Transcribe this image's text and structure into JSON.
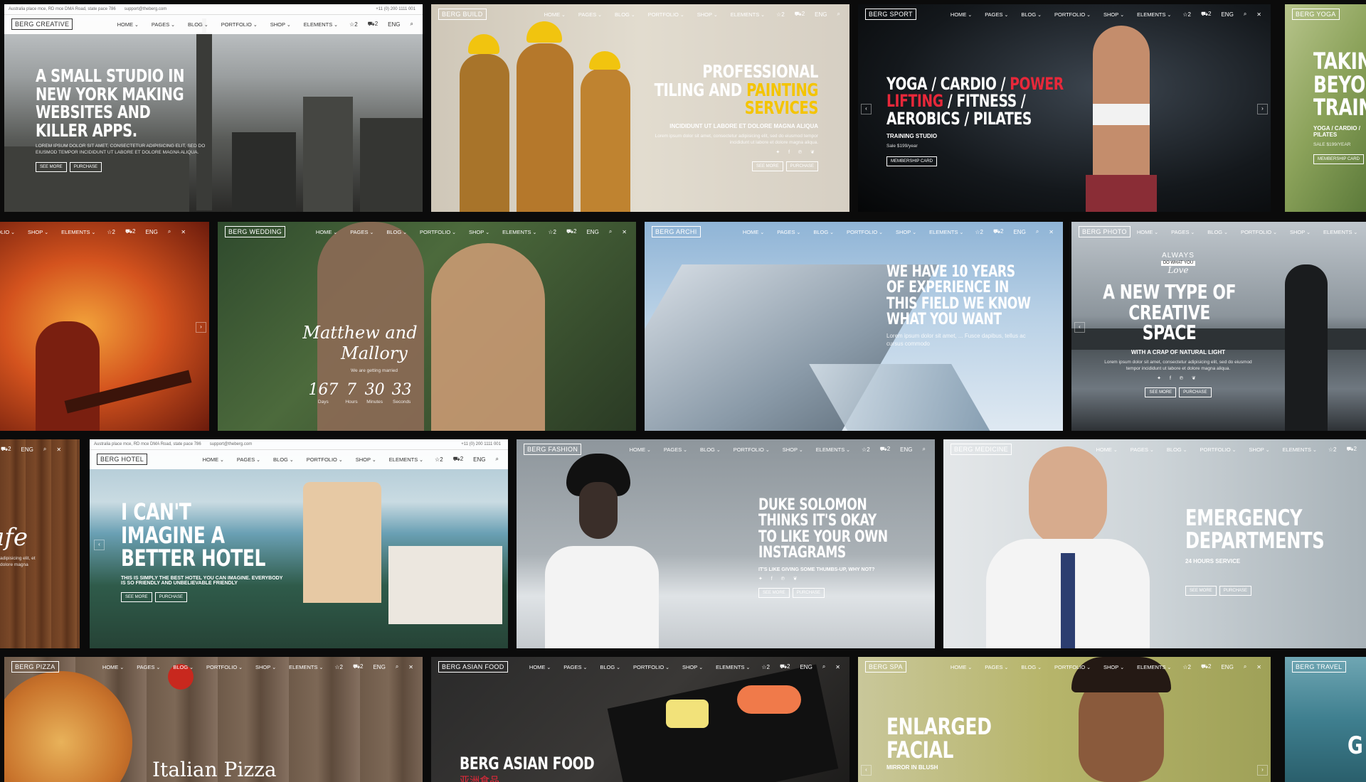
{
  "common_nav": {
    "home": "HOME",
    "pages": "PAGES",
    "blog": "BLOG",
    "portfolio": "PORTFOLIO",
    "shop": "SHOP",
    "elements": "ELEMENTS",
    "wishlist": "☆2",
    "cart": "⛟2",
    "lang": "ENG",
    "search_icon": "⌕",
    "close_icon": "✕"
  },
  "creative": {
    "logo": "BERG CREATIVE",
    "topbar_address": "Australia place mce, RD mce DMA Road, state pace 786",
    "topbar_email": "support@theberg.com",
    "topbar_phone": "+11 (0) 200 1111 001",
    "title": "A SMALL STUDIO IN NEW YORK MAKING WEBSITES AND KILLER APPS.",
    "body": "LOREM IPSUM DOLOR SIT AMET, CONSECTETUR ADIPISICING ELIT, SED DO EIUSMOD TEMPOR INCIDIDUNT UT LABORE ET DOLORE MAGNA ALIQUA.",
    "btn1": "SEE MORE",
    "btn2": "PURCHASE"
  },
  "build": {
    "logo": "BERG BUILD",
    "title_a": "PROFESSIONAL TILING AND",
    "title_b": "PAINTING SERVICES",
    "sub": "INCIDIDUNT UT LABORE ET DOLORE MAGNA ALIQUA",
    "body": "Lorem ipsum dolor sit amet, consectetur adipisicing elit, sed do eiusmod tempor incididunt ut labore et dolore magna aliqua.",
    "social": "✦ f ℗ ❦",
    "btn1": "SEE MORE",
    "btn2": "PURCHASE"
  },
  "sport": {
    "logo": "BERG SPORT",
    "title_a": "YOGA / CARDIO /",
    "title_power": "POWER",
    "title_lifting": "LIFTING",
    "title_b": "/ FITNESS / AEROBICS / PILATES",
    "sub": "TRAINING STUDIO",
    "body": "Sale $199/year",
    "btn1": "MEMBERSHIP CARD"
  },
  "yoga": {
    "logo": "BERG YOGA",
    "title": "TAKING BEYOND TRAIN",
    "sub": "YOGA / CARDIO / PILATES",
    "body": "SALE $199/YEAR",
    "btn1": "MEMBERSHIP CARD"
  },
  "music": {},
  "wedding": {
    "logo": "BERG WEDDING",
    "names_a": "Matthew and",
    "names_b": "Mallory",
    "sub": "We are getting married",
    "c1": "167",
    "c2": "7",
    "c3": "30",
    "c4": "33",
    "l1": "Days",
    "l2": "Hours",
    "l3": "Minutes",
    "l4": "Seconds"
  },
  "archi": {
    "logo": "BERG ARCHI",
    "title": "WE HAVE 10 YEARS OF EXPERIENCE IN THIS FIELD WE KNOW WHAT YOU WANT",
    "body": "Lorem ipsum dolor sit amet, ... Fusce dapibus, tellus ac cursus commodo"
  },
  "photo": {
    "logo": "BERG PHOTO",
    "stamp_a": "ALWAYS",
    "stamp_b": "DO WHAT YOU",
    "stamp_c": "Love",
    "title": "A NEW TYPE OF CREATIVE SPACE",
    "sub": "WITH A CRAP OF NATURAL LIGHT",
    "body": "Lorem ipsum dolor sit amet, consectetur adipisicing elit, sed do eiusmod tempor incididunt ut labore et dolore magna aliqua.",
    "social": "✦ f ℗ ❦",
    "btn1": "SEE MORE",
    "btn2": "PURCHASE"
  },
  "cafe": {
    "script": "afe",
    "body": "adipisicing elit, et dolore magna"
  },
  "hotel": {
    "logo": "BERG HOTEL",
    "topbar_address": "Australia place mce, RD mce DMA Road, state pace 786",
    "topbar_email": "support@theberg.com",
    "topbar_phone": "+11 (0) 200 1111 001",
    "title": "I CAN'T IMAGINE A BETTER HOTEL",
    "body": "THIS IS SIMPLY THE BEST HOTEL YOU CAN IMAGINE. EVERYBODY IS SO FRIENDLY AND UNBELIEVABLE FRIENDLY",
    "btn1": "SEE MORE",
    "btn2": "PURCHASE"
  },
  "fashion": {
    "logo": "BERG FASHION",
    "title": "DUKE SOLOMON THINKS IT'S OKAY TO LIKE YOUR OWN INSTAGRAMS",
    "sub": "IT'S LIKE GIVING SOME THUMBS-UP, WHY NOT?",
    "social": "✦ f ℗ ❦",
    "btn1": "SEE MORE",
    "btn2": "PURCHASE"
  },
  "medicine": {
    "logo": "BERG MEDICINE",
    "title": "EMERGENCY DEPARTMENTS",
    "sub": "24 HOURS SERVICE",
    "btn1": "SEE MORE",
    "btn2": "PURCHASE"
  },
  "pizza": {
    "logo": "BERG PIZZA",
    "title": "Italian Pizza"
  },
  "asian": {
    "logo": "BERG ASIAN FOOD",
    "title": "BERG ASIAN FOOD",
    "cjk": "亚洲食品"
  },
  "spa": {
    "logo": "BERG SPA",
    "title": "ENLARGED FACIAL",
    "sub": "MIRROR IN BLUSH"
  },
  "travel": {
    "logo": "BERG TRAVEL",
    "title": "G"
  },
  "colors": {
    "accent_yellow": "#f4c400",
    "accent_red": "#e8283a"
  }
}
